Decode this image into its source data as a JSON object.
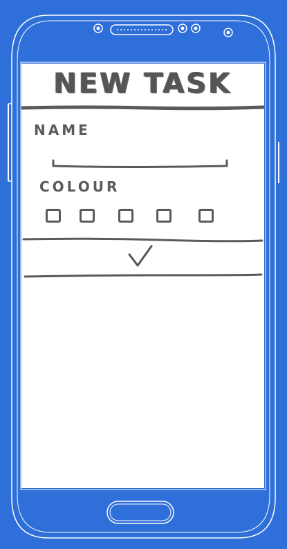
{
  "screen": {
    "title": "NEW TASK",
    "name_label": "NAME",
    "name_value": "",
    "colour_label": "COLOUR",
    "colour_options_count": 5,
    "confirm_icon": "check-icon"
  },
  "colors": {
    "background": "#2f6fd9",
    "sketch_ink": "#5a5a5a",
    "screen": "#ffffff"
  }
}
